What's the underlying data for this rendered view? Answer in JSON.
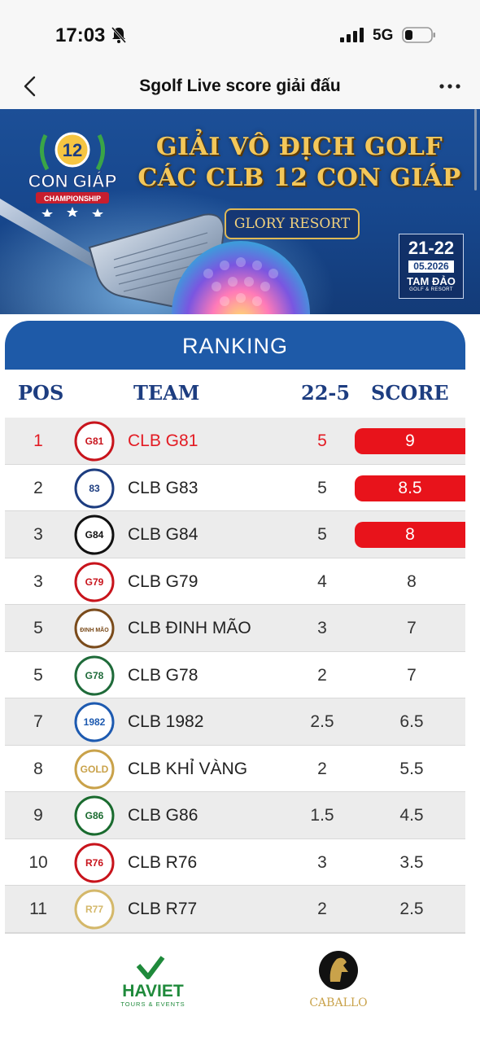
{
  "status_bar": {
    "time": "17:03",
    "network": "5G",
    "icons": [
      "bell-muted-icon",
      "signal-icon",
      "battery-icon"
    ]
  },
  "nav": {
    "title": "Sgolf Live score giải đấu",
    "back_icon": "chevron-left-icon",
    "more_icon": "more-horizontal-icon"
  },
  "banner": {
    "title_line1": "GIẢI VÔ ĐỊCH GOLF",
    "title_line2": "CÁC CLB 12 CON GIÁP",
    "resort": "GLORY RESORT",
    "logo_number": "12",
    "logo_name": "CON GIÁP",
    "logo_sub": "CHAMPIONSHIP",
    "date_range": "21-22",
    "date_month": "05.2026",
    "place": "TAM ĐẢO",
    "place_sub": "GOLF & RESORT"
  },
  "ranking": {
    "header": "RANKING",
    "columns": {
      "pos": "POS",
      "team": "TEAM",
      "round": "22-5",
      "score": "SCORE"
    },
    "rows": [
      {
        "pos": "1",
        "team": "CLB G81",
        "round": "5",
        "score": "9",
        "highlight": true,
        "leader": true,
        "logo_text": "G81"
      },
      {
        "pos": "2",
        "team": "CLB G83",
        "round": "5",
        "score": "8.5",
        "highlight": true,
        "leader": false,
        "logo_text": "83"
      },
      {
        "pos": "3",
        "team": "CLB G84",
        "round": "5",
        "score": "8",
        "highlight": true,
        "leader": false,
        "logo_text": "G84"
      },
      {
        "pos": "3",
        "team": "CLB G79",
        "round": "4",
        "score": "8",
        "highlight": false,
        "leader": false,
        "logo_text": "G79"
      },
      {
        "pos": "5",
        "team": "CLB ĐINH MÃO",
        "round": "3",
        "score": "7",
        "highlight": false,
        "leader": false,
        "logo_text": "ĐINH MÃO"
      },
      {
        "pos": "5",
        "team": "CLB G78",
        "round": "2",
        "score": "7",
        "highlight": false,
        "leader": false,
        "logo_text": "G78"
      },
      {
        "pos": "7",
        "team": "CLB 1982",
        "round": "2.5",
        "score": "6.5",
        "highlight": false,
        "leader": false,
        "logo_text": "1982"
      },
      {
        "pos": "8",
        "team": "CLB KHỈ VÀNG",
        "round": "2",
        "score": "5.5",
        "highlight": false,
        "leader": false,
        "logo_text": "GOLD"
      },
      {
        "pos": "9",
        "team": "CLB G86",
        "round": "1.5",
        "score": "4.5",
        "highlight": false,
        "leader": false,
        "logo_text": "G86"
      },
      {
        "pos": "10",
        "team": "CLB R76",
        "round": "3",
        "score": "3.5",
        "highlight": false,
        "leader": false,
        "logo_text": "R76"
      },
      {
        "pos": "11",
        "team": "CLB R77",
        "round": "2",
        "score": "2.5",
        "highlight": false,
        "leader": false,
        "logo_text": "R77"
      }
    ]
  },
  "footer": {
    "sponsor1": "HAVIET",
    "sponsor1_sub": "TOURS & EVENTS",
    "sponsor2": "CABALLO"
  },
  "colors": {
    "primary_blue": "#1e5aa8",
    "header_text_blue": "#1d3d80",
    "highlight_red": "#e8131b",
    "row_shade": "#ececec",
    "haviet_green": "#1f8a3b",
    "caballo_gold": "#c9a24a"
  }
}
